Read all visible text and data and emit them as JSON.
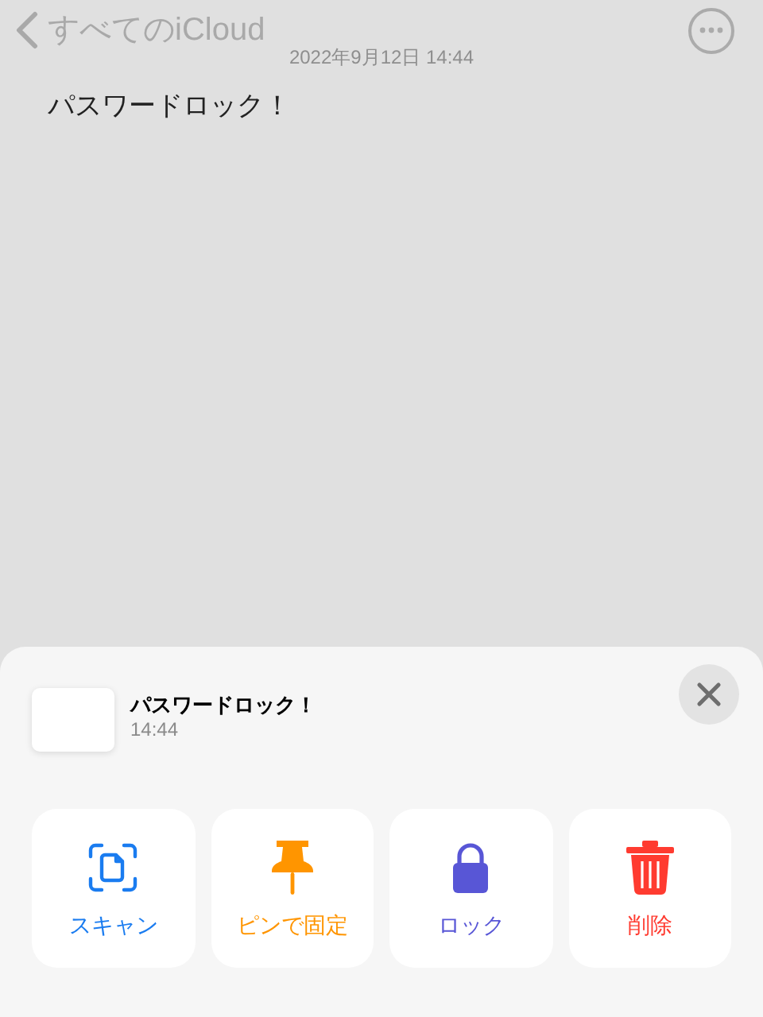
{
  "nav": {
    "back_label": "すべてのiCloud"
  },
  "note": {
    "date": "2022年9月12日 14:44",
    "body": "パスワードロック！"
  },
  "sheet": {
    "title": "パスワードロック！",
    "time": "14:44",
    "actions": [
      {
        "kind": "scan",
        "label": "スキャン",
        "color": "#1a7cf0"
      },
      {
        "kind": "pin",
        "label": "ピンで固定",
        "color": "#ff9500"
      },
      {
        "kind": "lock",
        "label": "ロック",
        "color": "#5856d6"
      },
      {
        "kind": "delete",
        "label": "削除",
        "color": "#ff3b30"
      }
    ]
  }
}
